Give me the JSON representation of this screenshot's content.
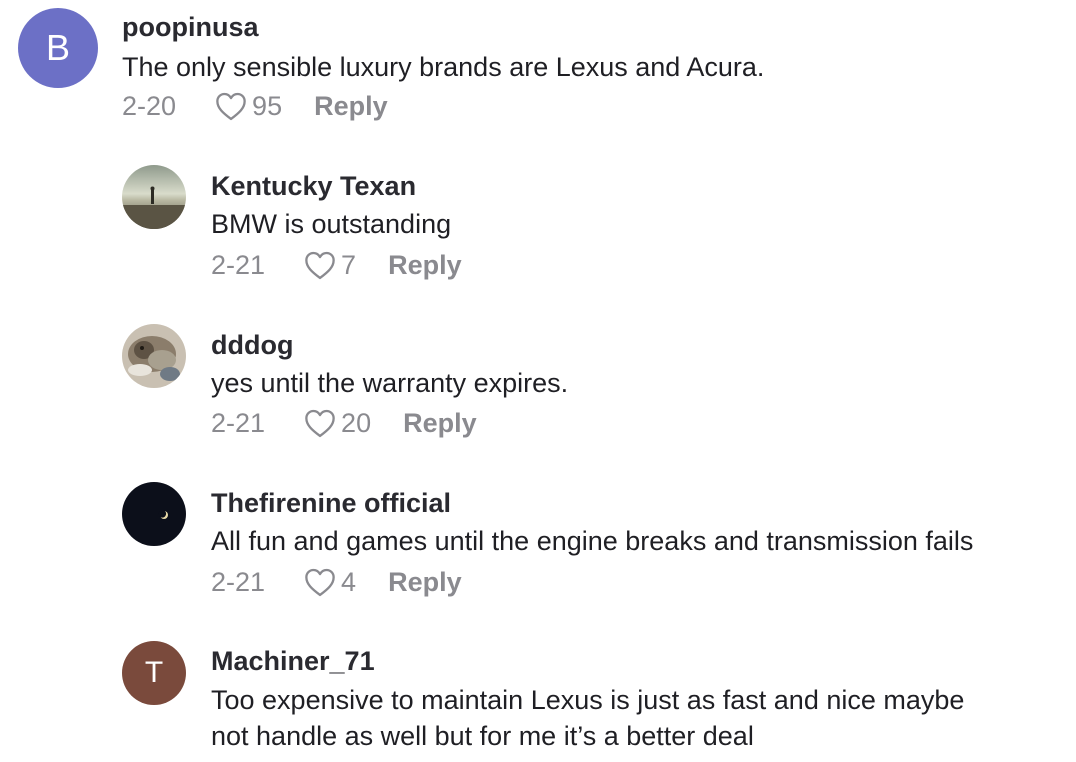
{
  "comments": [
    {
      "username": "poopinusa",
      "avatar_letter": "B",
      "avatar_color": "#6c70c6",
      "text": [
        "The only sensible luxury brands are Lexus and Acura."
      ],
      "date": "2-20",
      "likes": "95",
      "reply_label": "Reply"
    },
    {
      "username": "Kentucky Texan",
      "avatar_icon": "beach-photo",
      "text": [
        "BMW is outstanding"
      ],
      "date": "2-21",
      "likes": "7",
      "reply_label": "Reply"
    },
    {
      "username": "dddog",
      "avatar_icon": "dog-photo",
      "text": [
        "yes until the warranty expires."
      ],
      "date": "2-21",
      "likes": "20",
      "reply_label": "Reply"
    },
    {
      "username": "Thefirenine official",
      "avatar_icon": "moon-photo",
      "text": [
        "All fun and games until the engine breaks and transmission fails"
      ],
      "date": "2-21",
      "likes": "4",
      "reply_label": "Reply"
    },
    {
      "username": "Machiner_71",
      "avatar_letter": "T",
      "avatar_color": "#7a4a3c",
      "text": [
        "Too expensive to maintain Lexus is just as fast and nice maybe",
        "not handle as well but for me it’s a better deal"
      ]
    }
  ],
  "colors": {
    "text": "#1f1f24",
    "meta": "#8a8a8f"
  }
}
